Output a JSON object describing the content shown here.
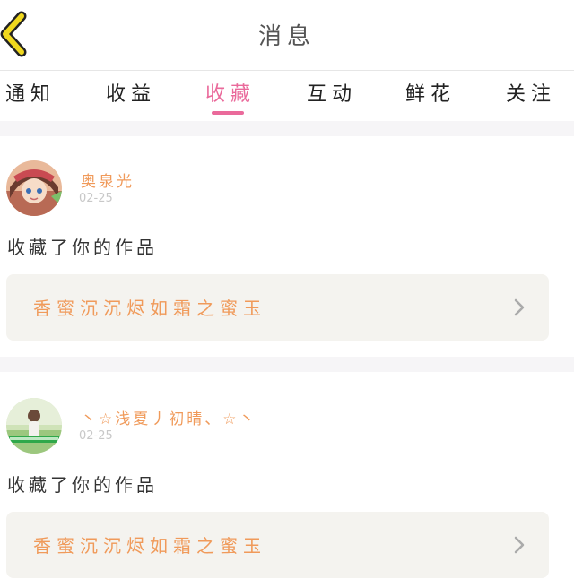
{
  "header": {
    "title": "消息",
    "back_icon": "chevron-left-icon"
  },
  "tabs": [
    {
      "label": "通知",
      "active": false
    },
    {
      "label": "收益",
      "active": false
    },
    {
      "label": "收藏",
      "active": true
    },
    {
      "label": "互动",
      "active": false
    },
    {
      "label": "鲜花",
      "active": false
    },
    {
      "label": "关注",
      "active": false
    }
  ],
  "colors": {
    "accent": "#ea6a9b",
    "name": "#f09a5a",
    "back_icon": "#f0d81e"
  },
  "messages": [
    {
      "user_name": "奥泉光",
      "time": "02-25",
      "action": "收藏了你的作品",
      "work_title": "香蜜沉沉烬如霜之蜜玉"
    },
    {
      "user_name": "丶☆浅夏丿初晴、☆丶",
      "time": "02-25",
      "action": "收藏了你的作品",
      "work_title": "香蜜沉沉烬如霜之蜜玉"
    }
  ]
}
